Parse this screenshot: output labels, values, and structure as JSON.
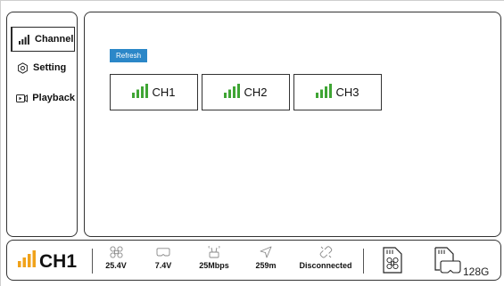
{
  "sidebar": {
    "items": [
      {
        "label": "Channel",
        "icon": "signal-bars-icon",
        "active": true
      },
      {
        "label": "Setting",
        "icon": "gear-icon",
        "active": false
      },
      {
        "label": "Playback",
        "icon": "playback-icon",
        "active": false
      }
    ]
  },
  "main": {
    "refresh_label": "Refresh",
    "channels": [
      {
        "label": "CH1",
        "icon": "signal-bars-icon"
      },
      {
        "label": "CH2",
        "icon": "signal-bars-icon"
      },
      {
        "label": "CH3",
        "icon": "signal-bars-icon"
      }
    ]
  },
  "status_bar": {
    "current_channel": "CH1",
    "stats": [
      {
        "icon": "drone-icon",
        "value": "25.4V"
      },
      {
        "icon": "goggles-icon",
        "value": "7.4V"
      },
      {
        "icon": "antenna-icon",
        "value": "25Mbps"
      },
      {
        "icon": "location-arrow-icon",
        "value": "259m"
      },
      {
        "icon": "link-broken-icon",
        "value": "Disconnected"
      }
    ],
    "storage": [
      {
        "icon": "sd-card-drone-icon",
        "value": ""
      },
      {
        "icon": "sd-card-goggles-icon",
        "value": "128G"
      }
    ]
  },
  "colors": {
    "signal_green": "#3fa534",
    "signal_orange": "#f0a21a",
    "accent_blue": "#2b87c8",
    "border": "#333333"
  }
}
